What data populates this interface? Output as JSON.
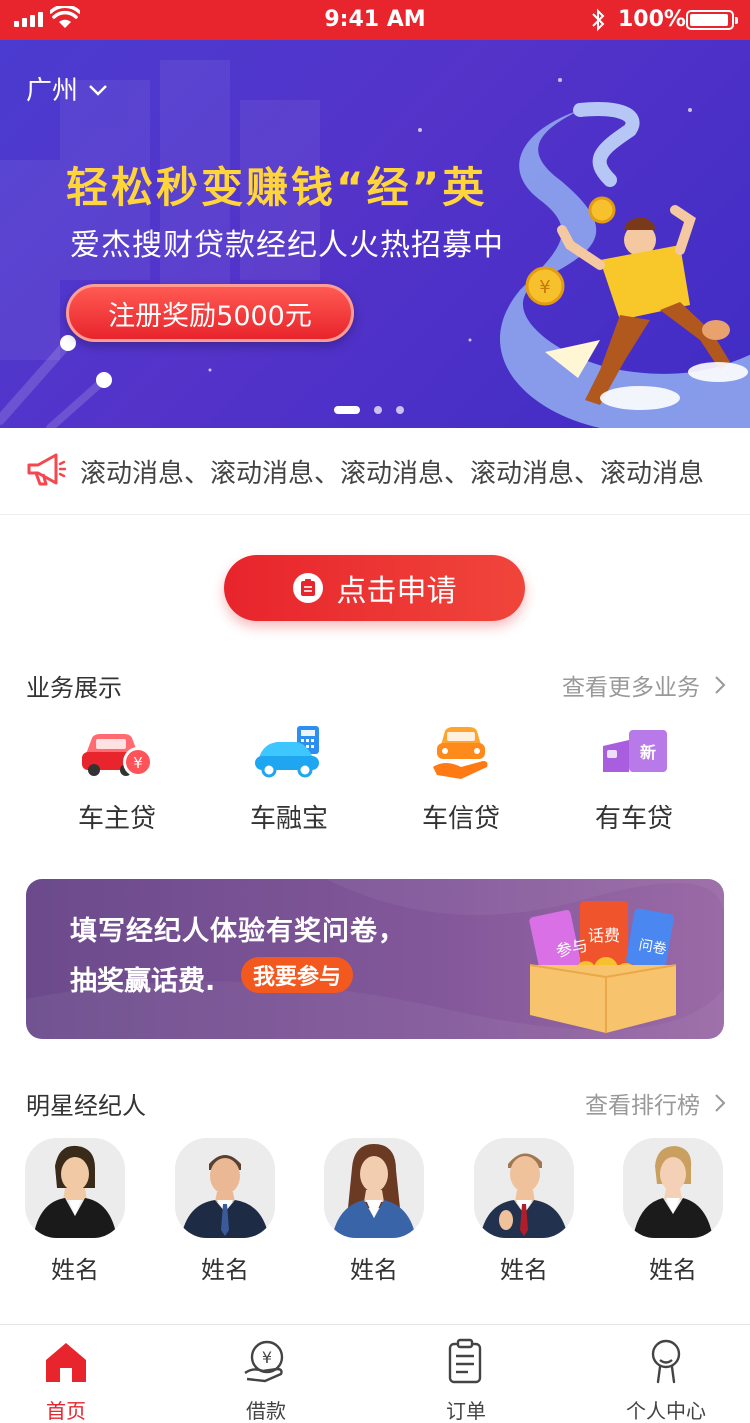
{
  "status_bar": {
    "time": "9:41 AM",
    "battery": "100%"
  },
  "banner": {
    "city": "广州",
    "title": "轻松秒变赚钱“经”英",
    "subtitle": "爱杰搜财贷款经纪人火热招募中",
    "cta": "注册奖励5000元",
    "slide_count": 3,
    "active_slide": 1
  },
  "notice": {
    "text": "滚动消息、滚动消息、滚动消息、滚动消息、滚动消息"
  },
  "apply_button": {
    "label": "点击申请"
  },
  "services_section": {
    "title": "业务展示",
    "more": "查看更多业务",
    "items": [
      {
        "label": "车主贷",
        "icon": "car-yuan-icon"
      },
      {
        "label": "车融宝",
        "icon": "car-calculator-icon"
      },
      {
        "label": "车信贷",
        "icon": "car-hand-icon"
      },
      {
        "label": "有车贷",
        "icon": "new-car-icon"
      }
    ]
  },
  "survey": {
    "line1": "填写经纪人体验有奖问卷，",
    "line2": "抽奖赢话费.",
    "join": "我要参与",
    "tickets": [
      "参与",
      "话费",
      "问卷"
    ]
  },
  "agents_section": {
    "title": "明星经纪人",
    "more": "查看排行榜",
    "agents": [
      {
        "name": "姓名"
      },
      {
        "name": "姓名"
      },
      {
        "name": "姓名"
      },
      {
        "name": "姓名"
      },
      {
        "name": "姓名"
      }
    ]
  },
  "tabbar": {
    "tabs": [
      {
        "label": "首页",
        "icon": "home-icon",
        "active": true
      },
      {
        "label": "借款",
        "icon": "loan-icon",
        "active": false
      },
      {
        "label": "订单",
        "icon": "order-icon",
        "active": false
      },
      {
        "label": "个人中心",
        "icon": "profile-icon",
        "active": false
      }
    ]
  },
  "colors": {
    "brand_red": "#e8242c",
    "banner_purple": "#4b3bd0",
    "title_yellow": "#ffd53a"
  }
}
